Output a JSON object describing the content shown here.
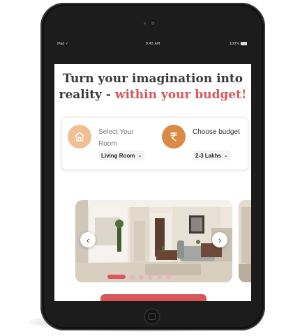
{
  "status_bar": {
    "carrier": "iPad",
    "time": "9:45 AM",
    "battery": "100%"
  },
  "headline": {
    "line1": "Turn your imagination into",
    "line2_prefix": "reality - ",
    "line2_accent": "within your budget!"
  },
  "selectors": {
    "room": {
      "label": "Select Your Room",
      "value": "Living Room"
    },
    "budget": {
      "label": "Choose budget",
      "value": "2-3 Lakhs"
    }
  },
  "carousel": {
    "prev_label": "‹",
    "next_label": "›",
    "slide_count": 6,
    "active_index": 0
  },
  "colors": {
    "accent": "#d9575a",
    "room_icon_bg": "#f0bf92",
    "budget_icon_bg": "#d98a45"
  },
  "icons": {
    "room": "house-icon",
    "budget": "rupee-icon"
  }
}
